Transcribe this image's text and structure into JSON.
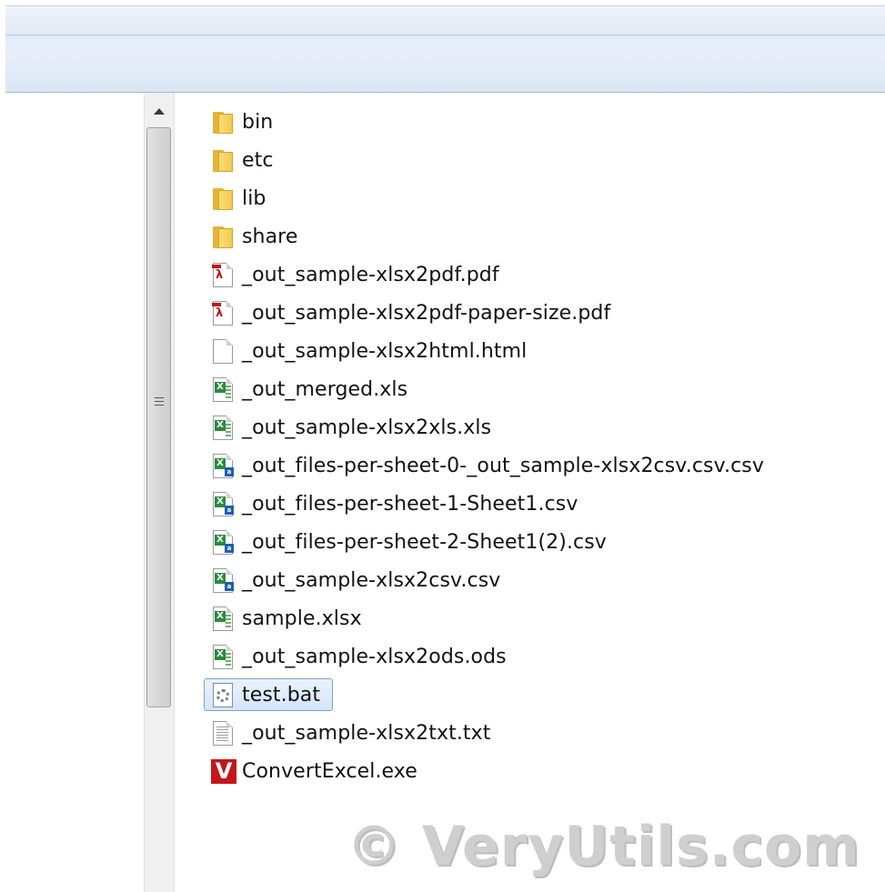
{
  "files": [
    {
      "name": "bin",
      "icon": "folder-icon",
      "type": "folder"
    },
    {
      "name": "etc",
      "icon": "folder-icon",
      "type": "folder"
    },
    {
      "name": "lib",
      "icon": "folder-icon",
      "type": "folder"
    },
    {
      "name": "share",
      "icon": "folder-icon",
      "type": "folder"
    },
    {
      "name": "_out_sample-xlsx2pdf.pdf",
      "icon": "pdf-file-icon",
      "type": "pdf"
    },
    {
      "name": "_out_sample-xlsx2pdf-paper-size.pdf",
      "icon": "pdf-file-icon",
      "type": "pdf"
    },
    {
      "name": "_out_sample-xlsx2html.html",
      "icon": "blank-file-icon",
      "type": "blank"
    },
    {
      "name": "_out_merged.xls",
      "icon": "excel-file-icon",
      "type": "excel"
    },
    {
      "name": "_out_sample-xlsx2xls.xls",
      "icon": "excel-file-icon",
      "type": "excel"
    },
    {
      "name": "_out_files-per-sheet-0-_out_sample-xlsx2csv.csv.csv",
      "icon": "csv-file-icon",
      "type": "csv"
    },
    {
      "name": "_out_files-per-sheet-1-Sheet1.csv",
      "icon": "csv-file-icon",
      "type": "csv"
    },
    {
      "name": "_out_files-per-sheet-2-Sheet1(2).csv",
      "icon": "csv-file-icon",
      "type": "csv"
    },
    {
      "name": "_out_sample-xlsx2csv.csv",
      "icon": "csv-file-icon",
      "type": "csv"
    },
    {
      "name": "sample.xlsx",
      "icon": "excel-file-icon",
      "type": "excel"
    },
    {
      "name": "_out_sample-xlsx2ods.ods",
      "icon": "excel-file-icon",
      "type": "excel"
    },
    {
      "name": "test.bat",
      "icon": "batch-file-icon",
      "type": "bat",
      "selected": true
    },
    {
      "name": "_out_sample-xlsx2txt.txt",
      "icon": "text-file-icon",
      "type": "txt"
    },
    {
      "name": "ConvertExcel.exe",
      "icon": "convertexcel-app-icon",
      "type": "exe"
    }
  ],
  "watermark": "© VeryUtils.com",
  "colors": {
    "selection_border": "#7da2ce",
    "selection_fill": "#d3e5fb",
    "exe_brand": "#c4161c"
  }
}
